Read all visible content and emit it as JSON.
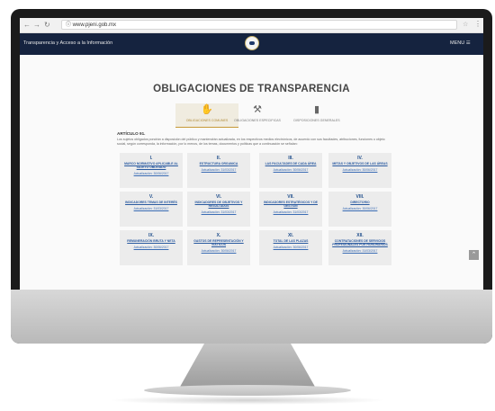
{
  "browser": {
    "url": "www.pjeni.gob.mx",
    "back_icon": "arrow-left",
    "forward_icon": "arrow-right",
    "reload_icon": "reload"
  },
  "site": {
    "name": "Transparencia y Acceso a la Información",
    "menu_label": "MENU ☰"
  },
  "page": {
    "title": "OBLIGACIONES DE TRANSPARENCIA",
    "tabs": [
      {
        "label": "OBLIGACIONES COMUNES",
        "icon": "handshake-icon"
      },
      {
        "label": "OBLIGACIONES ESPECIFICAS",
        "icon": "gavel-icon"
      },
      {
        "label": "DISPOSICIONES GENERALES",
        "icon": "bookmark-icon"
      }
    ],
    "article": "ARTÍCULO 91.",
    "description": "Los sujetos obligados pondrán a disposición del público y mantendrán actualizada, en los respectivos medios electrónicos, de acuerdo con sus facultades, atribuciones, funciones u objeto social, según corresponda, la información, por lo menos, de los temas, documentos y políticas que a continuación se señalan:",
    "cards": [
      {
        "num": "I.",
        "title": "MARCO NORMATIVO APLICABLE AL SUJETO OBLIGADO",
        "update": "Actualización: 30/06/2017"
      },
      {
        "num": "II.",
        "title": "ESTRUCTURA ORGANICA",
        "update": "Actualización: 31/03/2017"
      },
      {
        "num": "III.",
        "title": "LAS FACULTADES DE CADA ÁREA",
        "update": "Actualización: 30/06/2017"
      },
      {
        "num": "IV.",
        "title": "METAS Y OBJETIVOS DE LAS ÁREAS",
        "update": "Actualización: 30/06/2017"
      },
      {
        "num": "V.",
        "title": "INDICADORES TEMAS DE INTERÉS",
        "update": "Actualización: 31/03/2017"
      },
      {
        "num": "VI.",
        "title": "INDICADORES DE OBJETIVOS Y RESULTADOS",
        "update": "Actualización: 31/03/2017"
      },
      {
        "num": "VII.",
        "title": "INDICADORES ESTRATÉGICOS Y DE GESTIÓN",
        "update": "Actualización: 31/03/2017"
      },
      {
        "num": "VIII.",
        "title": "DIRECTORIO",
        "update": "Actualización: 30/06/2017"
      },
      {
        "num": "IX.",
        "title": "REMUNERACIÓN BRUTA Y NETA",
        "update": "Actualización: 30/06/2017"
      },
      {
        "num": "X.",
        "title": "GASTOS DE REPRESENTACIÓN Y VIÁTICOS",
        "update": "Actualización: 30/06/2017"
      },
      {
        "num": "XI.",
        "title": "TOTAL DE LAS PLAZAS",
        "update": "Actualización: 30/06/2017"
      },
      {
        "num": "XII.",
        "title": "CONTRATACIONES DE SERVICIOS PROFESIONALES POR HONORARIOS",
        "update": "Actualización: 31/03/2017"
      }
    ],
    "scroll_top_icon": "chevron-up"
  },
  "colors": {
    "header": "#15233f",
    "accent": "#b08a37",
    "link": "#2a5aa0",
    "card_bg": "#ececec"
  }
}
